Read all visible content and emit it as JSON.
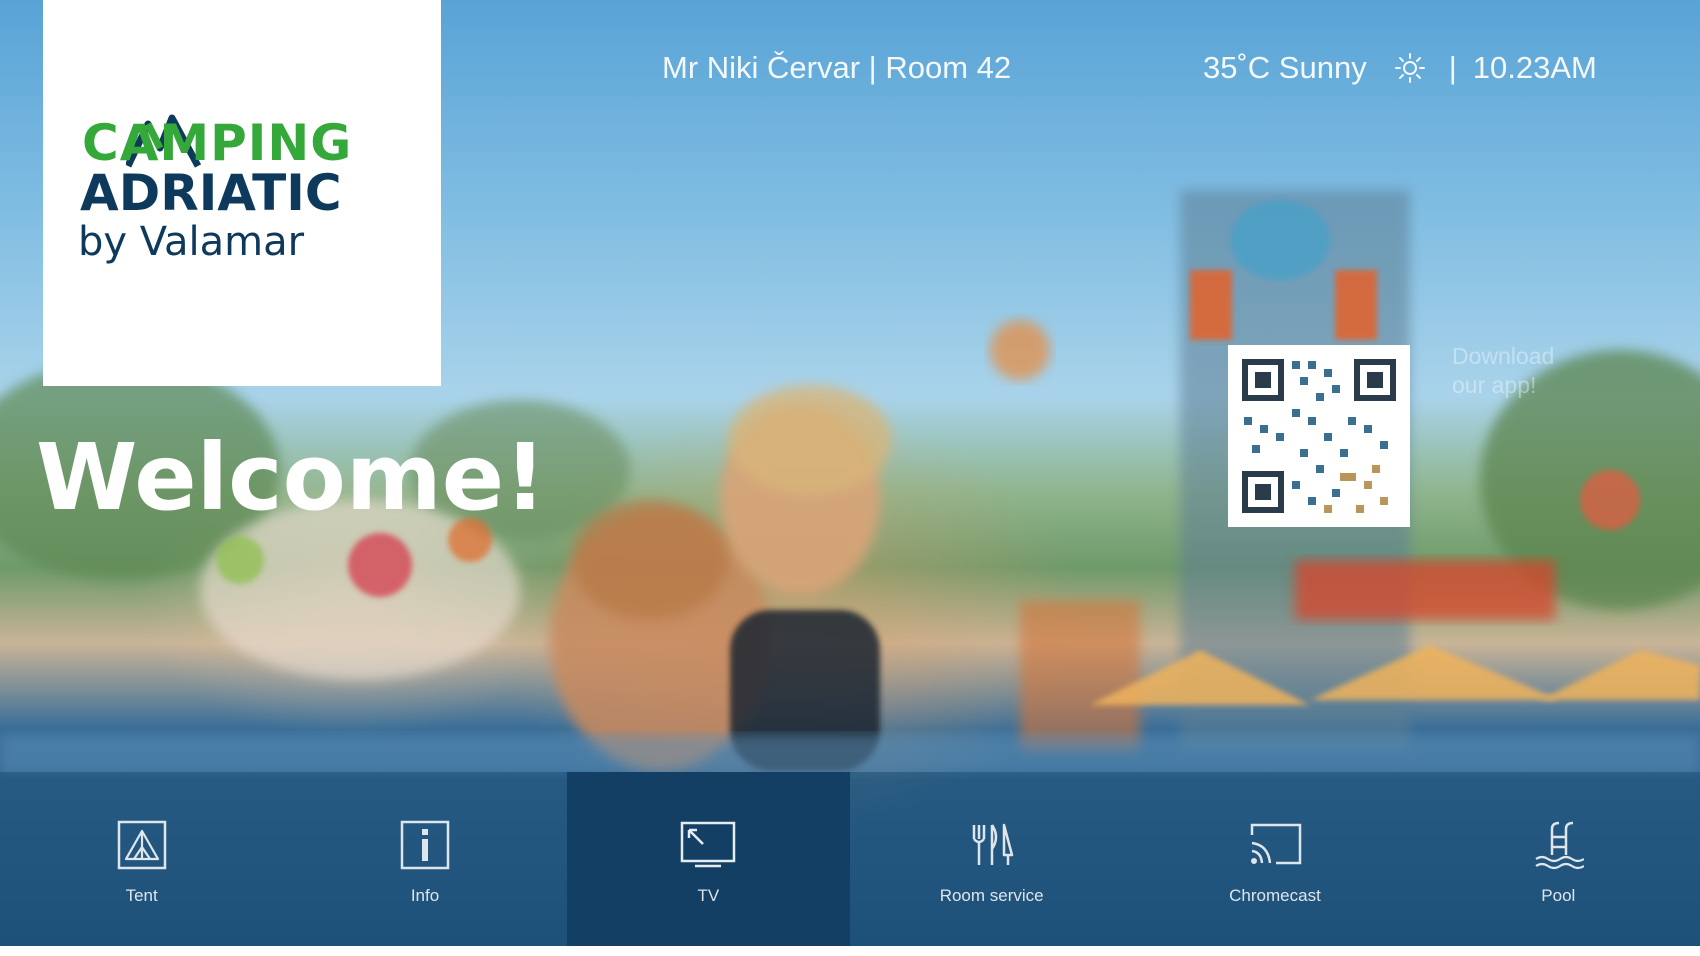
{
  "header": {
    "guest_room": "Mr Niki Červar | Room 42",
    "temperature": "35˚C Sunny",
    "separator": "|",
    "time": "10.23AM"
  },
  "logo": {
    "line1": "CAMPING",
    "line2": "ADRIATIC",
    "line3": "by Valamar",
    "colors": {
      "green": "#35a83a",
      "navy": "#0d3a5c"
    }
  },
  "hero": {
    "welcome": "Welcome!"
  },
  "qr": {
    "caption_line1": "Download",
    "caption_line2": "our app!"
  },
  "nav": {
    "items": [
      {
        "label": "Tent",
        "icon": "tent-icon"
      },
      {
        "label": "Info",
        "icon": "info-icon"
      },
      {
        "label": "TV",
        "icon": "tv-icon",
        "active": true
      },
      {
        "label": "Room service",
        "icon": "room-service-icon"
      },
      {
        "label": "Chromecast",
        "icon": "chromecast-icon"
      },
      {
        "label": "Pool",
        "icon": "pool-icon"
      }
    ]
  }
}
